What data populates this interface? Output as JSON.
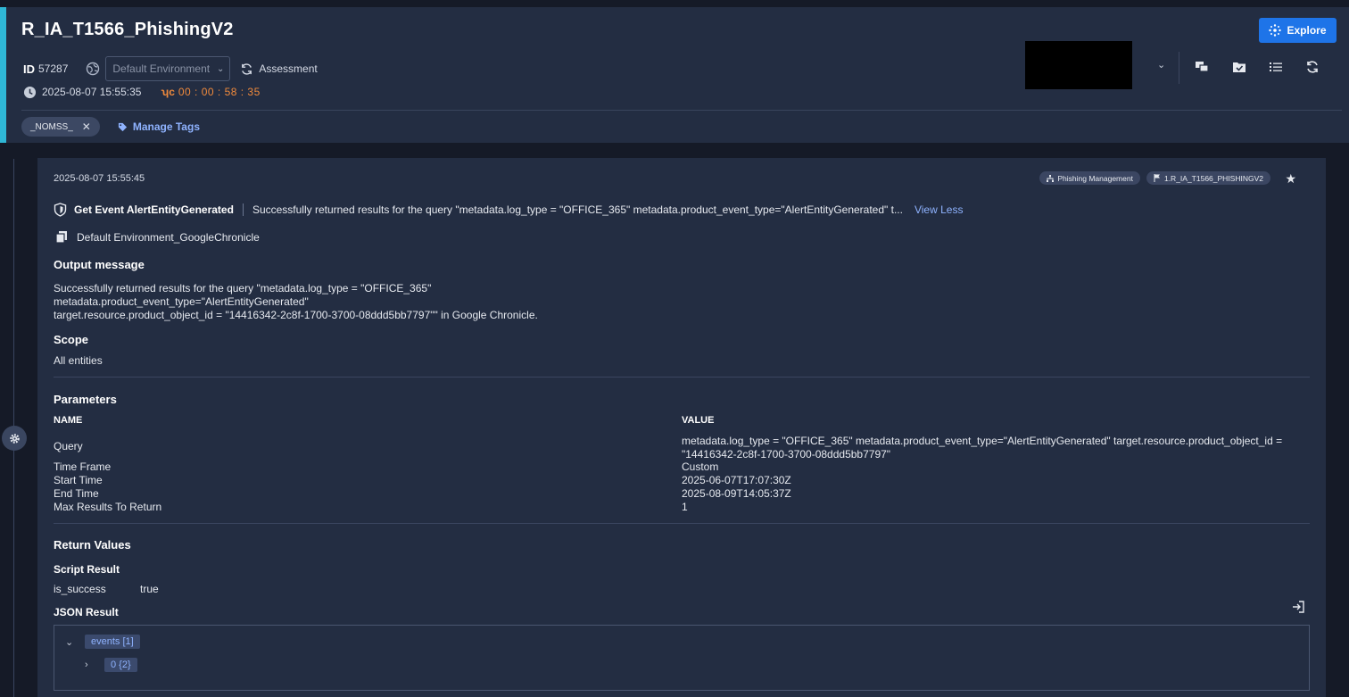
{
  "header": {
    "title": "R_IA_T1566_PhishingV2",
    "id_label": "ID",
    "id_value": "57287",
    "environment": "Default Environment",
    "assessment_label": "Assessment",
    "timestamp": "2025-08-07 15:55:35",
    "timer": "00 : 00 : 58 : 35",
    "tag": "_NOMSS_",
    "manage_tags_label": "Manage Tags",
    "explore_label": "Explore"
  },
  "event": {
    "timestamp": "2025-08-07 15:55:45",
    "badges": [
      "Phishing Management",
      "1.R_IA_T1566_PHISHINGV2"
    ],
    "name": "Get Event AlertEntityGenerated",
    "summary": "Successfully returned results for the query \"metadata.log_type = \"OFFICE_365\" metadata.product_event_type=\"AlertEntityGenerated\" t...",
    "view_less_label": "View Less",
    "integration": "Default Environment_GoogleChronicle",
    "output_title": "Output message",
    "output_lines": [
      "Successfully returned results for the query \"metadata.log_type = \"OFFICE_365\"",
      "metadata.product_event_type=\"AlertEntityGenerated\"",
      "target.resource.product_object_id = \"14416342-2c8f-1700-3700-08ddd5bb7797\"\" in Google Chronicle."
    ],
    "scope_title": "Scope",
    "scope_value": "All entities",
    "params_title": "Parameters",
    "params_name_header": "NAME",
    "params_value_header": "VALUE",
    "params": [
      {
        "name": "Query",
        "value": "metadata.log_type = \"OFFICE_365\" metadata.product_event_type=\"AlertEntityGenerated\" target.resource.product_object_id = \"14416342-2c8f-1700-3700-08ddd5bb7797\""
      },
      {
        "name": "Time Frame",
        "value": "Custom"
      },
      {
        "name": "Start Time",
        "value": "2025-06-07T17:07:30Z"
      },
      {
        "name": "End Time",
        "value": "2025-08-09T14:05:37Z"
      },
      {
        "name": "Max Results To Return",
        "value": "1"
      }
    ],
    "return_title": "Return Values",
    "script_result_title": "Script Result",
    "script_result_key": "is_success",
    "script_result_value": "true",
    "json_result_title": "JSON Result",
    "json_tree": [
      "events [1]",
      "0 {2}"
    ]
  }
}
